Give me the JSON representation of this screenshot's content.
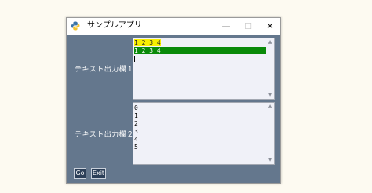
{
  "window": {
    "title": "サンプルアプリ",
    "minimize_glyph": "—",
    "maximize_glyph": "☐",
    "close_glyph": "✕"
  },
  "labels": {
    "output1": "テキスト出力欄１",
    "output2": "テキスト出力欄２"
  },
  "output1": {
    "lines": [
      "1 2 3 4",
      "1 2 3 4"
    ],
    "highlight_colors": [
      "#f8ef00",
      "#0a8a0a"
    ]
  },
  "output2": {
    "lines": [
      "0",
      "1",
      "2",
      "3",
      "4",
      "5"
    ]
  },
  "buttons": {
    "go": "Go",
    "exit": "Exit"
  },
  "scrollbar": {
    "up": "▲",
    "down": "▼"
  }
}
